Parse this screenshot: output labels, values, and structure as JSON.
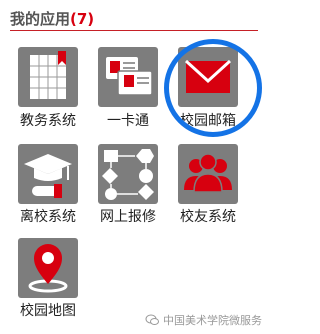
{
  "header": {
    "title": "我的应用",
    "count": "(7)"
  },
  "apps": [
    {
      "label": "教务系统",
      "icon": "calendar-icon"
    },
    {
      "label": "一卡通",
      "icon": "card-icon"
    },
    {
      "label": "校园邮箱",
      "icon": "mail-icon"
    },
    {
      "label": "离校系统",
      "icon": "graduation-icon"
    },
    {
      "label": "网上报修",
      "icon": "flowchart-icon"
    },
    {
      "label": "校友系统",
      "icon": "people-icon"
    },
    {
      "label": "校园地图",
      "icon": "map-pin-icon"
    }
  ],
  "watermark": {
    "text": "中国美术学院微服务"
  },
  "colors": {
    "accent": "#c62026",
    "red": "#d7000f",
    "tile": "#7d7d7d",
    "highlight": "#1473e6"
  }
}
